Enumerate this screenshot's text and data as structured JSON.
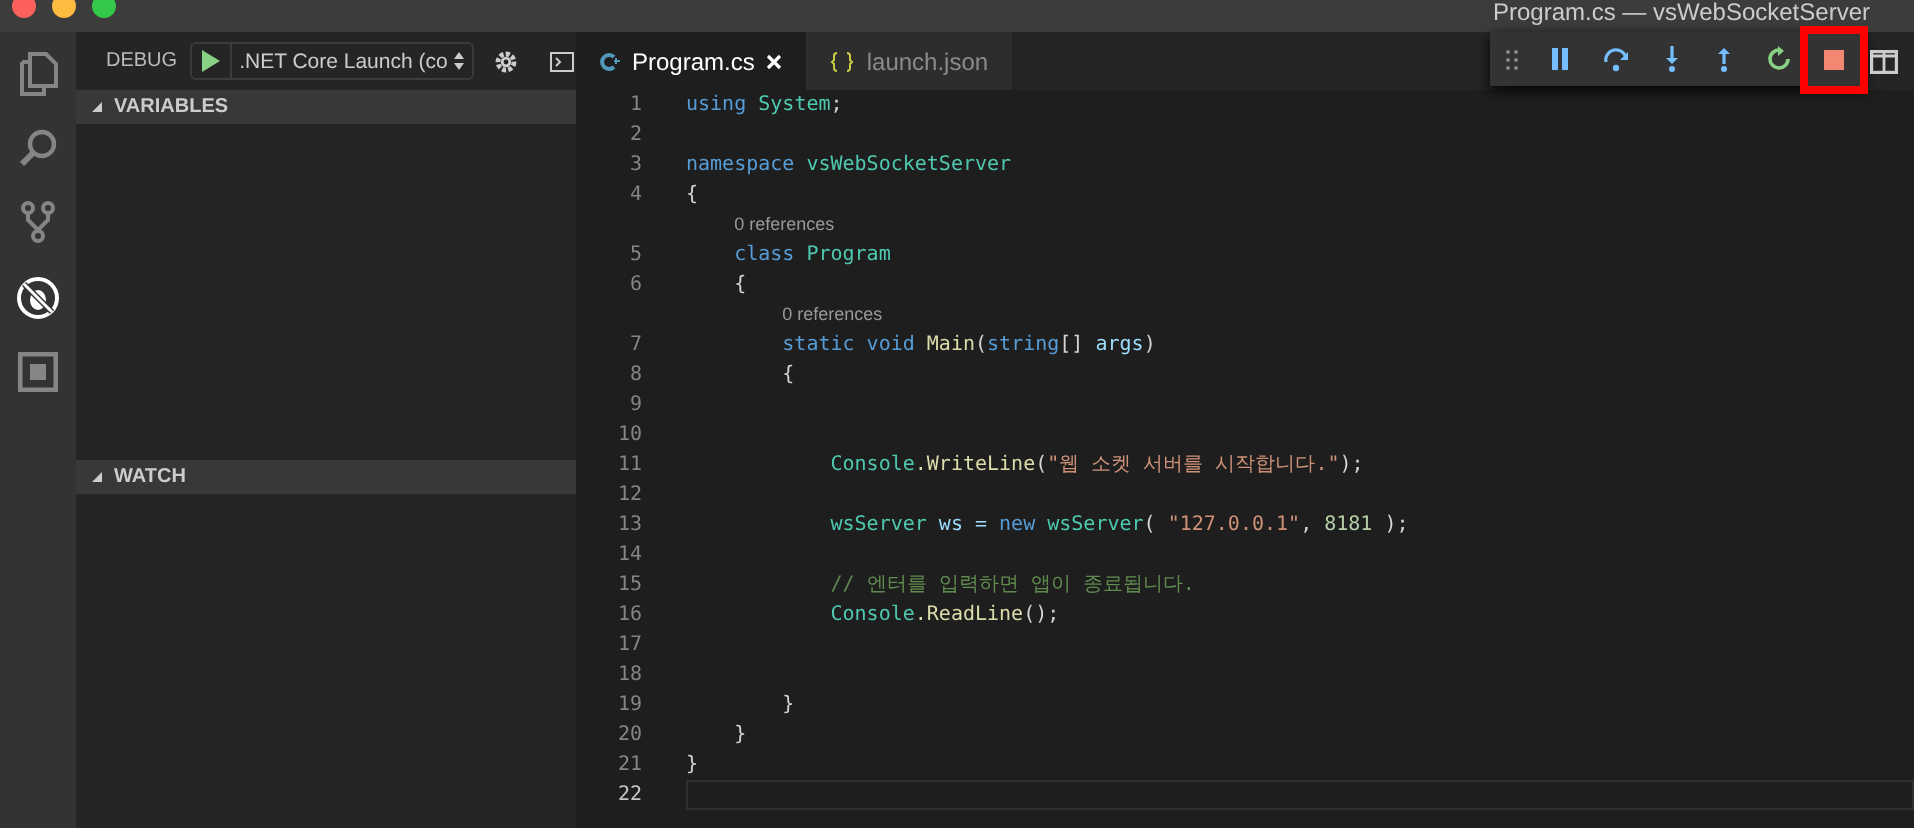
{
  "window": {
    "title": "Program.cs — vsWebSocketServer"
  },
  "activity_bar": [
    {
      "kind": "files",
      "selected": false
    },
    {
      "kind": "search",
      "selected": false
    },
    {
      "kind": "git",
      "selected": false
    },
    {
      "kind": "debug",
      "selected": true
    },
    {
      "kind": "extensions",
      "selected": false
    }
  ],
  "sidebar": {
    "title": "DEBUG",
    "configuration": ".NET Core Launch (co",
    "sections": [
      {
        "title": "VARIABLES",
        "expanded": true
      },
      {
        "title": "WATCH",
        "expanded": true
      }
    ]
  },
  "tabs": [
    {
      "label": "Program.cs",
      "kind": "csharp",
      "selected": true
    },
    {
      "label": "launch.json",
      "kind": "json",
      "selected": false
    }
  ],
  "debug_toolbar": [
    {
      "kind": "pause",
      "highlighted": false
    },
    {
      "kind": "step-over",
      "highlighted": false
    },
    {
      "kind": "step-into",
      "highlighted": false
    },
    {
      "kind": "step-out",
      "highlighted": false
    },
    {
      "kind": "restart",
      "highlighted": false
    },
    {
      "kind": "stop",
      "highlighted": true
    }
  ],
  "code": [
    {
      "number": "1",
      "current": false,
      "tokens": [
        {
          "t": "using",
          "color": "#569cd6"
        },
        {
          "t": " System",
          "color": "#4ec9b0"
        },
        {
          "t": ";",
          "color": "#d4d4d4"
        }
      ]
    },
    {
      "number": "2",
      "current": false
    },
    {
      "number": "3",
      "current": false,
      "tokens": [
        {
          "t": "namespace",
          "color": "#569cd6"
        },
        {
          "t": " vsWebSocketServer",
          "color": "#4ec9b0"
        }
      ]
    },
    {
      "number": "4",
      "current": false,
      "tokens": [
        {
          "t": "{",
          "color": "#d4d4d4"
        }
      ]
    },
    {
      "kind": "codelens",
      "text": "0 references"
    },
    {
      "number": "5",
      "current": false,
      "tokens": [
        {
          "t": "    class",
          "color": "#569cd6"
        },
        {
          "t": " Program",
          "color": "#4ec9b0"
        }
      ]
    },
    {
      "number": "6",
      "current": false,
      "tokens": [
        {
          "t": "    {",
          "color": "#d4d4d4"
        }
      ]
    },
    {
      "kind": "codelens",
      "text": "0 references"
    },
    {
      "number": "7",
      "current": false,
      "tokens": [
        {
          "t": "        static void",
          "color": "#569cd6"
        },
        {
          "t": " Main",
          "color": "#dcdcaa"
        },
        {
          "t": "(",
          "color": "#d4d4d4"
        },
        {
          "t": "string",
          "color": "#569cd6"
        },
        {
          "t": "[] ",
          "color": "#d4d4d4"
        },
        {
          "t": "args",
          "color": "#9cdcfe"
        },
        {
          "t": ")",
          "color": "#d4d4d4"
        }
      ]
    },
    {
      "number": "8",
      "current": false,
      "tokens": [
        {
          "t": "        {",
          "color": "#d4d4d4"
        }
      ]
    },
    {
      "number": "9",
      "current": false
    },
    {
      "number": "10",
      "current": false
    },
    {
      "number": "11",
      "current": false,
      "tokens": [
        {
          "t": "            Console",
          "color": "#4ec9b0"
        },
        {
          "t": ".WriteLine",
          "color": "#dcdcaa"
        },
        {
          "t": "(",
          "color": "#d4d4d4"
        },
        {
          "t": "\"웹 소켓 서버를 시작합니다.\"",
          "color": "#ce9178"
        },
        {
          "t": ");",
          "color": "#d4d4d4"
        }
      ]
    },
    {
      "number": "12",
      "current": false
    },
    {
      "number": "13",
      "current": false,
      "tokens": [
        {
          "t": "            wsServer",
          "color": "#4ec9b0"
        },
        {
          "t": " ws = ",
          "color": "#9cdcfe"
        },
        {
          "t": "new",
          "color": "#569cd6"
        },
        {
          "t": " wsServer",
          "color": "#4ec9b0"
        },
        {
          "t": "( ",
          "color": "#d4d4d4"
        },
        {
          "t": "\"127.0.0.1\"",
          "color": "#ce9178"
        },
        {
          "t": ", ",
          "color": "#d4d4d4"
        },
        {
          "t": "8181",
          "color": "#b5cea8"
        },
        {
          "t": " );",
          "color": "#d4d4d4"
        }
      ]
    },
    {
      "number": "14",
      "current": false
    },
    {
      "number": "15",
      "current": false,
      "tokens": [
        {
          "t": "            // 엔터를 입력하면 앱이 종료됩니다.",
          "color": "#608b4e"
        }
      ]
    },
    {
      "number": "16",
      "current": false,
      "tokens": [
        {
          "t": "            Console",
          "color": "#4ec9b0"
        },
        {
          "t": ".ReadLine",
          "color": "#dcdcaa"
        },
        {
          "t": "();",
          "color": "#d4d4d4"
        }
      ]
    },
    {
      "number": "17",
      "current": false
    },
    {
      "number": "18",
      "current": false
    },
    {
      "number": "19",
      "current": false,
      "tokens": [
        {
          "t": "        }",
          "color": "#d4d4d4"
        }
      ]
    },
    {
      "number": "20",
      "current": false,
      "tokens": [
        {
          "t": "    }",
          "color": "#d4d4d4"
        }
      ]
    },
    {
      "number": "21",
      "current": false,
      "tokens": [
        {
          "t": "}",
          "color": "#d4d4d4"
        }
      ]
    },
    {
      "number": "22",
      "current": true
    }
  ]
}
